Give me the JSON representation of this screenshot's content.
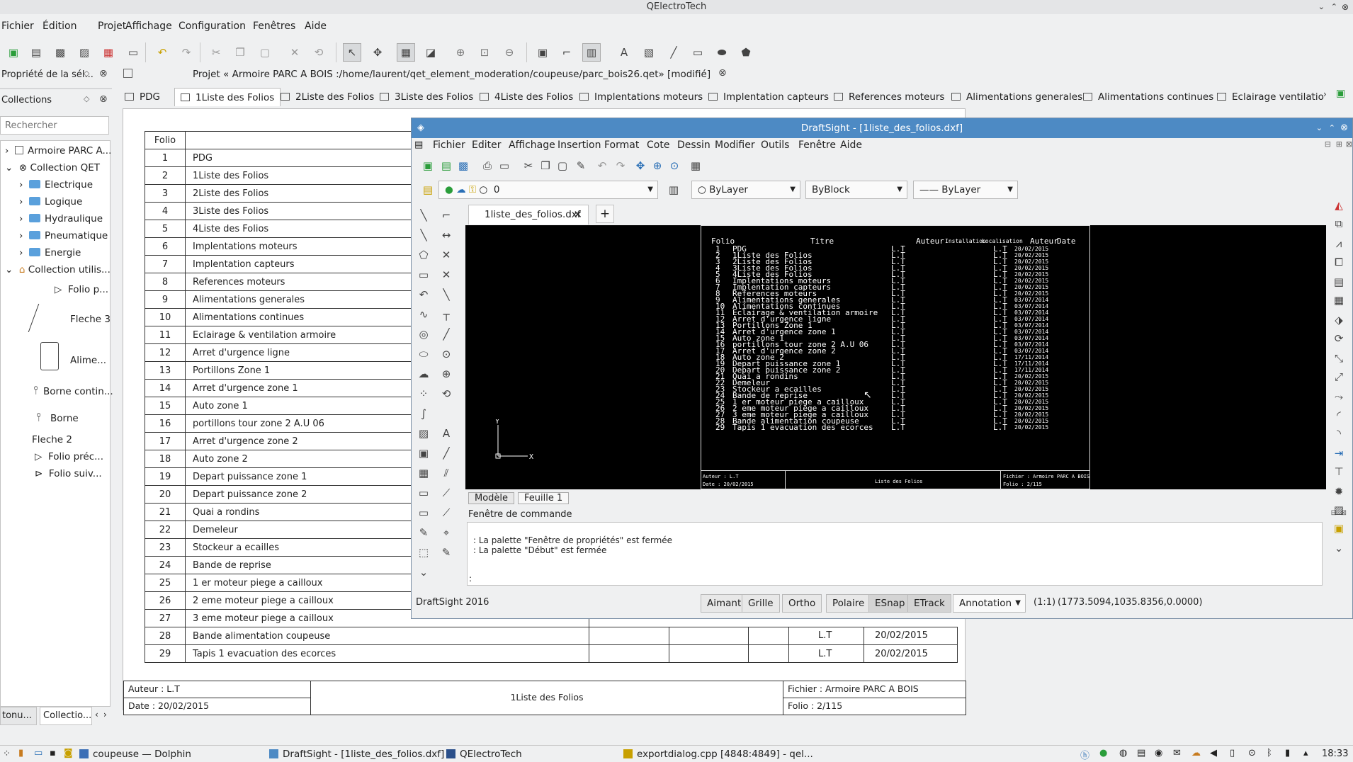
{
  "app": {
    "title": "QElectroTech"
  },
  "menu": [
    "Fichier",
    "Édition",
    "Projet",
    "Affichage",
    "Configuration",
    "Fenêtres",
    "Aide"
  ],
  "panels": {
    "properties_title": "Propriété de la sél...",
    "collections_title": "Collections",
    "search_placeholder": "Rechercher",
    "tree": {
      "root": "Armoire PARC A...",
      "collection_qet": "Collection QET",
      "folders": [
        "Electrique",
        "Logique",
        "Hydraulique",
        "Pneumatique",
        "Energie"
      ],
      "user_collection": "Collection utilis...",
      "items": [
        "Folio p...",
        "Fleche 3",
        "Alime...",
        "Borne contin...",
        "Borne"
      ],
      "fleche2": "Fleche 2",
      "fleche2_children": [
        "Folio préc...",
        "Folio suiv..."
      ]
    },
    "bottom_tabs": [
      "tonu...",
      "Collectio..."
    ]
  },
  "project": {
    "title": "Projet « Armoire PARC A BOIS :/home/laurent/qet_element_moderation/coupeuse/parc_bois26.qet» [modifié]",
    "tabs": [
      "PDG",
      "1Liste des Folios",
      "2Liste des Folios",
      "3Liste des Folios",
      "4Liste des Folios",
      "Implentations moteurs",
      "Implentation capteurs",
      "References moteurs",
      "Alimentations generales",
      "Alimentations continues",
      "Eclairage ventilatio"
    ],
    "active_tab": 1
  },
  "folio_table": {
    "headers": [
      "Folio",
      "Titre"
    ],
    "rows": [
      [
        "1",
        "PDG"
      ],
      [
        "2",
        "1Liste des Folios"
      ],
      [
        "3",
        "2Liste des Folios"
      ],
      [
        "4",
        "3Liste des Folios"
      ],
      [
        "5",
        "4Liste des Folios"
      ],
      [
        "6",
        "Implentations moteurs"
      ],
      [
        "7",
        "Implentation capteurs"
      ],
      [
        "8",
        "References moteurs"
      ],
      [
        "9",
        "Alimentations generales"
      ],
      [
        "10",
        "Alimentations continues"
      ],
      [
        "11",
        "Eclairage & ventilation armoire"
      ],
      [
        "12",
        "Arret d'urgence ligne"
      ],
      [
        "13",
        "Portillons Zone 1"
      ],
      [
        "14",
        "Arret d'urgence zone 1"
      ],
      [
        "15",
        "Auto zone 1"
      ],
      [
        "16",
        "portillons tour zone 2 A.U 06"
      ],
      [
        "17",
        "Arret d'urgence zone 2"
      ],
      [
        "18",
        "Auto zone 2"
      ],
      [
        "19",
        "Depart puissance zone 1"
      ],
      [
        "20",
        "Depart puissance zone 2"
      ],
      [
        "21",
        "Quai a rondins"
      ],
      [
        "22",
        "Demeleur"
      ],
      [
        "23",
        "Stockeur a ecailles"
      ],
      [
        "24",
        "Bande de reprise"
      ],
      [
        "25",
        "1 er moteur piege a cailloux"
      ],
      [
        "26",
        "2 eme moteur piege a cailloux"
      ],
      [
        "27",
        "3 eme moteur piege a cailloux"
      ],
      [
        "28",
        "Bande alimentation coupeuse"
      ],
      [
        "29",
        "Tapis 1 evacuation des ecorces"
      ]
    ],
    "tail_rows": [
      {
        "author": "L.T",
        "date": "20/02/2015"
      },
      {
        "author": "L.T",
        "date": "20/02/2015"
      }
    ]
  },
  "cartouche": {
    "auteur": "Auteur : L.T",
    "date": "Date : 20/02/2015",
    "titre": "1Liste des Folios",
    "fichier": "Fichier : Armoire PARC A BOIS",
    "folio": "Folio : 2/115"
  },
  "draftsight": {
    "title": "DraftSight - [1liste_des_folios.dxf]",
    "menu": [
      "Fichier",
      "Editer",
      "Affichage",
      "Insertion",
      "Format",
      "Cote",
      "Dessin",
      "Modifier",
      "Outils",
      "Fenêtre",
      "Aide"
    ],
    "layer_value": "0",
    "color_combo": "ByLayer",
    "linetype_combo": "ByBlock",
    "lineweight_combo": "—— ByLayer",
    "doc_tab": "1liste_des_folios.dxf",
    "layout_tabs": [
      "Modèle",
      "Feuille 1"
    ],
    "command_title": "Fenêtre de commande",
    "command_lines": [
      ": La palette \"Fenêtre de propriétés\" est fermée",
      ": La palette \"Début\" est fermée",
      ":"
    ],
    "status_label": "DraftSight 2016",
    "status_buttons": [
      "Aimant",
      "Grille",
      "Ortho",
      "Polaire",
      "ESnap",
      "ETrack"
    ],
    "annotation": "Annotation",
    "scale": "(1:1)",
    "coords": "(1773.5094,1035.8356,0.0000)",
    "cad_header": [
      "Folio",
      "Titre",
      "Auteur",
      "Installation",
      "Localisation",
      "Auteur",
      "Date"
    ],
    "cad_dates": [
      "20/02/2015",
      "20/02/2015",
      "20/02/2015",
      "20/02/2015",
      "20/02/2015",
      "20/02/2015",
      "20/02/2015",
      "20/02/2015",
      "03/07/2014",
      "03/07/2014",
      "03/07/2014",
      "03/07/2014",
      "03/07/2014",
      "03/07/2014",
      "03/07/2014",
      "03/07/2014",
      "03/07/2014",
      "17/11/2014",
      "17/11/2014",
      "17/11/2014",
      "20/02/2015",
      "20/02/2015",
      "20/02/2015",
      "20/02/2015",
      "20/02/2015",
      "20/02/2015",
      "20/02/2015",
      "20/02/2015",
      "20/02/2015"
    ],
    "cad_author": "L.T",
    "cad_cartouche": {
      "auteur": "Auteur : L.T",
      "date": "Date : 20/02/2015",
      "titre": "Liste des Folios",
      "fichier": "Fichier : Armoire PARC A BOIS",
      "folio": "Folio : 2/115"
    },
    "axis_x": "X",
    "axis_y": "Y"
  },
  "taskbar": {
    "tasks": [
      "coupeuse — Dolphin",
      "DraftSight - [1liste_des_folios.dxf]",
      "QElectroTech",
      "exportdialog.cpp [4848:4849] - qel..."
    ],
    "clock": "18:33"
  }
}
